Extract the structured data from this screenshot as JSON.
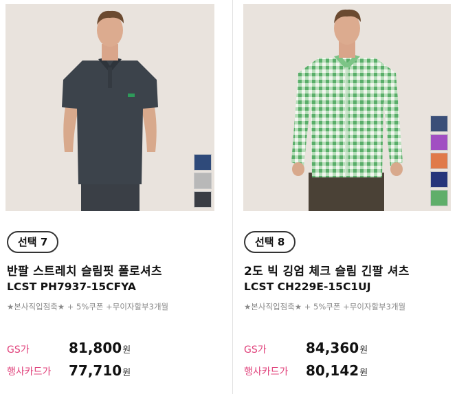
{
  "products": [
    {
      "badge": "선택 7",
      "title": "반팔 스트레치 슬림핏 폴로셔츠",
      "code": "LCST PH7937-15CFYA",
      "benefit": "★본사직입점축★ + 5%쿠폰 +무이자할부3개월",
      "gs_label": "GS가",
      "gs_price": "81,800",
      "card_label": "행사카드가",
      "card_price": "77,710",
      "currency": "원",
      "swatch_colors": [
        "#2f4a7a",
        "#b8b8b8",
        "#3a3d44"
      ]
    },
    {
      "badge": "선택 8",
      "title": "2도 빅 깅엄 체크 슬림 긴팔 셔츠",
      "code": "LCST CH229E-15C1UJ",
      "benefit": "★본사직입점축★ + 5%쿠폰 +무이자할부3개월",
      "gs_label": "GS가",
      "gs_price": "84,360",
      "card_label": "행사카드가",
      "card_price": "80,142",
      "currency": "원",
      "swatch_colors": [
        "#3b4f78",
        "#a14fc2",
        "#e07a4a",
        "#26357a",
        "#5fae6a"
      ]
    }
  ],
  "colors": {
    "accent_pink": "#e0407a",
    "photo_bg": "#e9e3dd",
    "polo": "#3c434b",
    "check_green": "#6fbf7a"
  }
}
